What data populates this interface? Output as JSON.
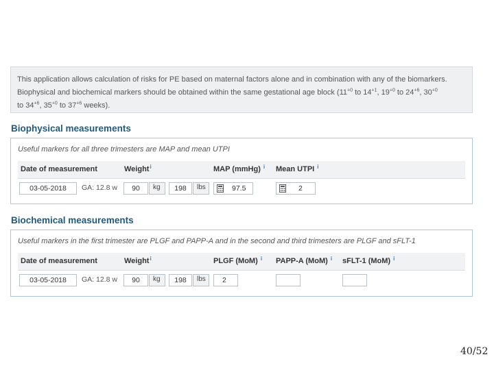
{
  "info": {
    "line1": "This application allows calculation of risks for PE based on maternal factors alone and in combination with any of the biomarkers.",
    "line2_a": "Biophysical and biochemical markers should be obtained within the same gestational age block (11",
    "sup1": "+0",
    "line2_b": " to 14",
    "sup2": "+1",
    "line2_c": ", 19",
    "sup3": "+0",
    "line2_d": " to 24",
    "sup4": "+6",
    "line2_e": ", 30",
    "sup5": "+0",
    "line3_a": "to 34",
    "sup6": "+6",
    "line3_b": ", 35",
    "sup7": "+0",
    "line3_c": " to 37",
    "sup8": "+6",
    "line3_d": " weeks)."
  },
  "biophysical": {
    "title": "Biophysical measurements",
    "hint": "Useful markers for all three trimesters are MAP and mean UTPI",
    "headers": {
      "date": "Date of measurement",
      "weight": "Weight",
      "map": "MAP (mmHg)",
      "utpi": "Mean UTPI"
    },
    "date": "03-05-2018",
    "ga": "GA: 12.8 w",
    "weight_kg": "90",
    "kg_unit": "kg",
    "weight_lbs": "198",
    "lbs_unit": "lbs",
    "map": "97.5",
    "utpi": "2"
  },
  "biochemical": {
    "title": "Biochemical measurements",
    "hint": "Useful markers in the first trimester are PLGF and PAPP-A and in the second and third trimesters are PLGF and sFLT-1",
    "headers": {
      "date": "Date of measurement",
      "weight": "Weight",
      "plgf": "PLGF (MoM)",
      "pappa": "PAPP-A (MoM)",
      "sflt": "sFLT-1 (MoM)"
    },
    "date": "03-05-2018",
    "ga": "GA: 12.8 w",
    "weight_kg": "90",
    "kg_unit": "kg",
    "weight_lbs": "198",
    "lbs_unit": "lbs",
    "plgf": "2",
    "pappa": "",
    "sflt": ""
  },
  "info_icon": "i",
  "page_number": "40/52",
  "colors": {
    "section_title": "#1f5a7f",
    "panel_border": "#a9c6dd",
    "info_bg": "#eef0f2"
  }
}
